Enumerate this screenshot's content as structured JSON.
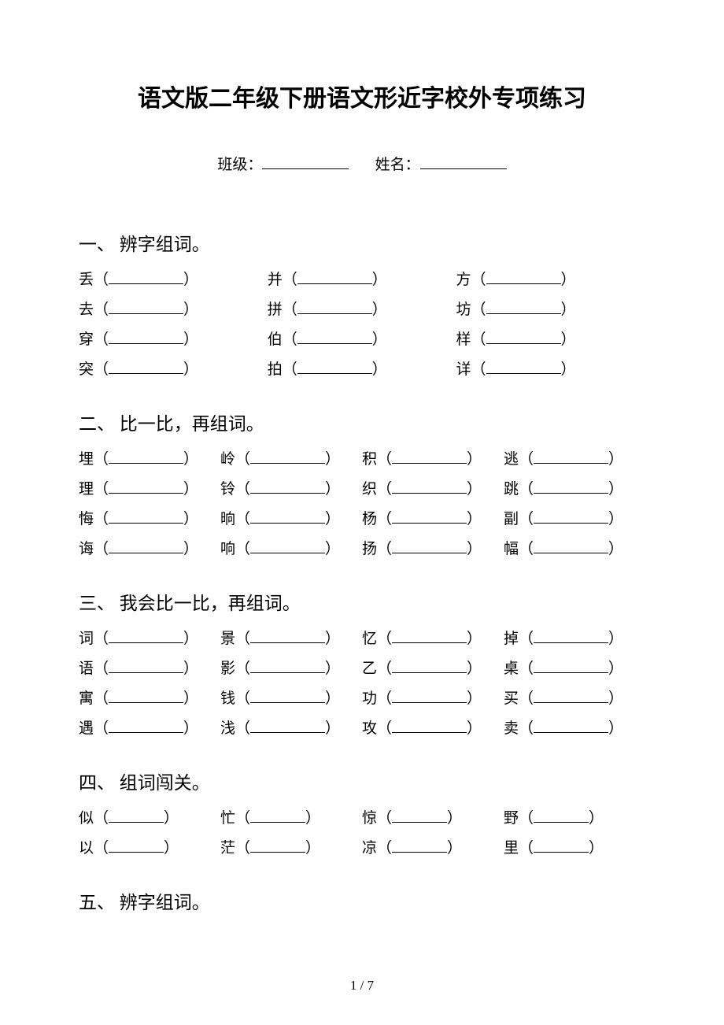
{
  "title": "语文版二年级下册语文形近字校外专项练习",
  "meta": {
    "class_label": "班级：",
    "name_label": "姓名："
  },
  "page_number": "1 / 7",
  "sections": {
    "s1": {
      "heading": "一、 辨字组词。",
      "rows": [
        [
          "丢",
          "并",
          "方"
        ],
        [
          "去",
          "拼",
          "坊"
        ],
        [
          "穿",
          "伯",
          "样"
        ],
        [
          "突",
          "拍",
          "详"
        ]
      ]
    },
    "s2": {
      "heading": "二、 比一比，再组词。",
      "rows": [
        [
          "埋",
          "岭",
          "积",
          "逃"
        ],
        [
          "理",
          "铃",
          "织",
          "跳"
        ],
        [
          "悔",
          "晌",
          "杨",
          "副"
        ],
        [
          "诲",
          "响",
          "扬",
          "幅"
        ]
      ]
    },
    "s3": {
      "heading": "三、 我会比一比，再组词。",
      "rows": [
        [
          "词",
          "景",
          "忆",
          "掉"
        ],
        [
          "语",
          "影",
          "乙",
          "桌"
        ],
        [
          "寓",
          "钱",
          "功",
          "买"
        ],
        [
          "遇",
          "浅",
          "攻",
          "卖"
        ]
      ]
    },
    "s4": {
      "heading": "四、 组词闯关。",
      "rows": [
        [
          "似",
          "忙",
          "惊",
          "野"
        ],
        [
          "以",
          "茫",
          "凉",
          "里"
        ]
      ]
    },
    "s5": {
      "heading": "五、 辨字组词。"
    }
  }
}
